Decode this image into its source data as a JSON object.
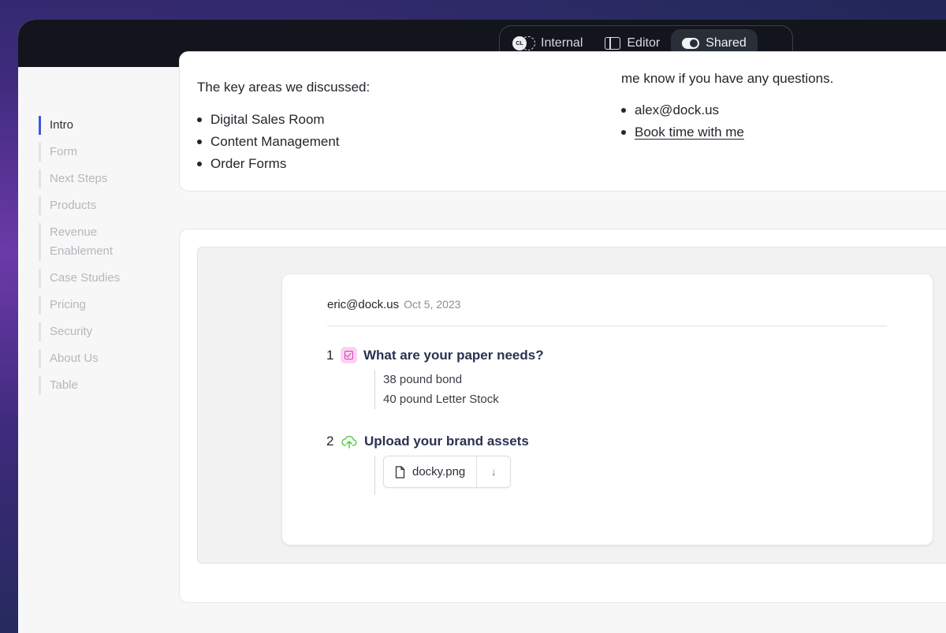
{
  "toolbar": {
    "modes": [
      {
        "label": "Internal",
        "icon": "avatar-group-icon",
        "avatar_initials": "CL"
      },
      {
        "label": "Editor",
        "icon": "sidebar-panel-icon"
      },
      {
        "label": "Shared",
        "icon": "toggle-icon",
        "active": true
      }
    ]
  },
  "toc": {
    "items": [
      {
        "label": "Intro",
        "active": true
      },
      {
        "label": "Form"
      },
      {
        "label": "Next Steps"
      },
      {
        "label": "Products"
      },
      {
        "label": "Revenue Enablement"
      },
      {
        "label": "Case Studies"
      },
      {
        "label": "Pricing"
      },
      {
        "label": "Security"
      },
      {
        "label": "About Us"
      },
      {
        "label": "Table"
      }
    ]
  },
  "intro": {
    "lead": "The key areas we discussed:",
    "areas": [
      "Digital Sales Room",
      "Content Management",
      "Order Forms"
    ],
    "right_text": "me know if you have any questions.",
    "contact_email": "alex@dock.us",
    "book_link": "Book time with me"
  },
  "submission": {
    "email": "eric@dock.us",
    "date": "Oct 5, 2023",
    "q1": {
      "number": "1",
      "title": "What are your paper needs?",
      "answers": [
        "38 pound bond",
        "40 pound Letter Stock"
      ]
    },
    "q2": {
      "number": "2",
      "title": "Upload your brand assets",
      "file_name": "docky.png",
      "download_glyph": "↓"
    }
  },
  "colors": {
    "accent": "#3b5bdb",
    "checkbox_bg": "#fbd3f1",
    "checkbox_fg": "#d63cb9",
    "upload_fg": "#5fd14a",
    "topbar_bg": "#12151c"
  }
}
